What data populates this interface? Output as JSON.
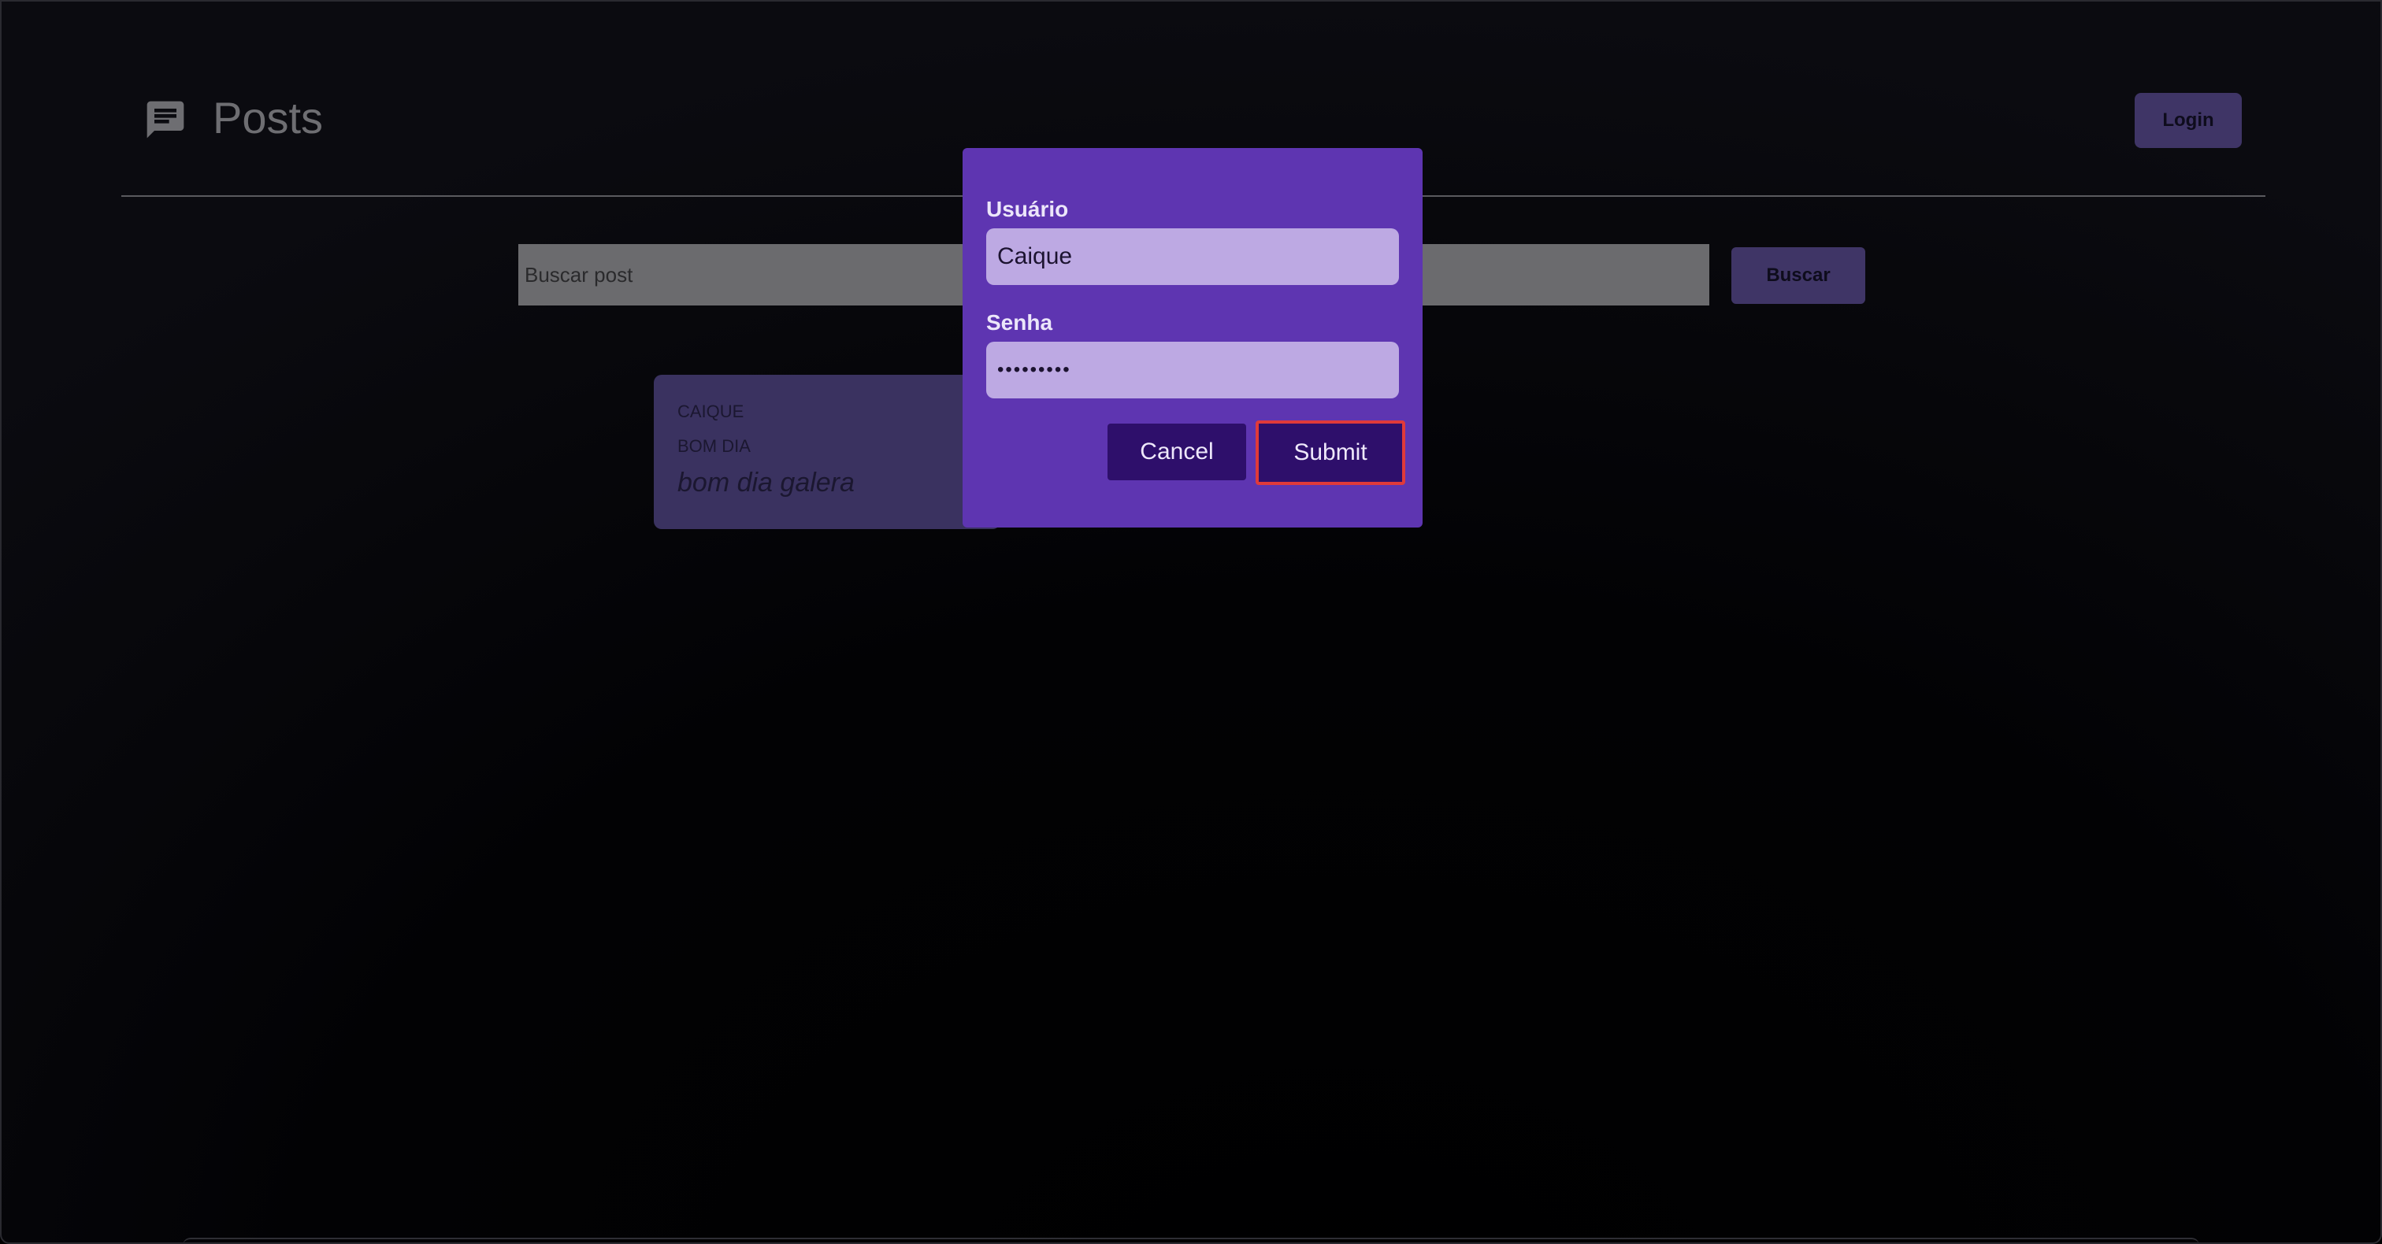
{
  "header": {
    "title": "Posts",
    "icon": "chat-bubble-icon",
    "login_label": "Login"
  },
  "search": {
    "placeholder": "Buscar post",
    "button_label": "Buscar"
  },
  "posts": [
    {
      "author": "CAIQUE",
      "title": "BOM DIA",
      "body": "bom dia galera"
    }
  ],
  "login_modal": {
    "username_label": "Usuário",
    "username_value": "Caique",
    "password_label": "Senha",
    "password_value": "•••••••••",
    "cancel_label": "Cancel",
    "submit_label": "Submit"
  },
  "colors": {
    "modal_background": "#5e35b1",
    "input_background": "#bda9e3",
    "button_background": "#2e0f6b",
    "focus_outline": "#e03a3a",
    "muted_button": "#3f3566"
  }
}
